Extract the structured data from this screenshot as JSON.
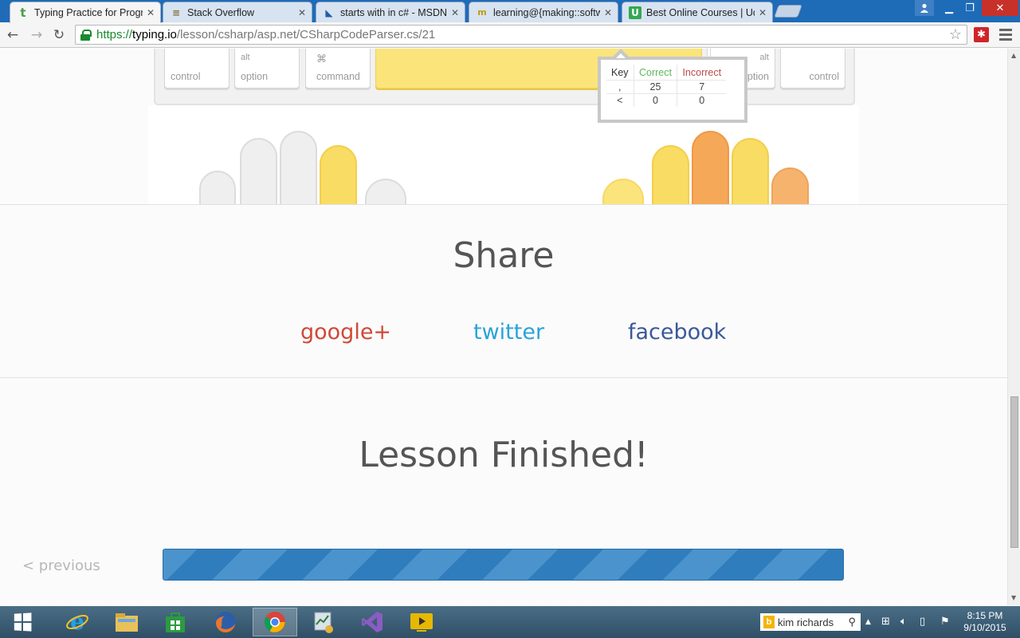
{
  "browser": {
    "tabs": [
      {
        "title": "Typing Practice for Progra",
        "favicon": "typing-io-icon",
        "active": true
      },
      {
        "title": "Stack Overflow",
        "favicon": "stackoverflow-icon",
        "active": false
      },
      {
        "title": "starts with in c# - MSDN S",
        "favicon": "msdn-icon",
        "active": false
      },
      {
        "title": "learning@{making::softwa",
        "favicon": "blog-icon",
        "active": false
      },
      {
        "title": "Best Online Courses | Ude",
        "favicon": "udemy-icon",
        "active": false
      }
    ],
    "url_scheme": "https://",
    "url_host": "typing.io",
    "url_path": "/lesson/csharp/asp.net/CSharpCodeParser.cs/21",
    "extension_label": "✱"
  },
  "keyboard": {
    "keys": {
      "left_control": "control",
      "left_option_sup": "alt",
      "left_option": "option",
      "command_sup": "⌘",
      "command": "command",
      "right_option_sup": "alt",
      "right_option": "option",
      "right_control": "control"
    }
  },
  "stats_tooltip": {
    "headers": [
      "Key",
      "Correct",
      "Incorrect"
    ],
    "rows": [
      {
        "key": ",",
        "correct": "25",
        "incorrect": "7"
      },
      {
        "key": "<",
        "correct": "0",
        "incorrect": "0"
      }
    ],
    "colors": {
      "correct": "#5cb85c",
      "incorrect": "#b94a48"
    }
  },
  "share": {
    "title": "Share",
    "google": "google+",
    "twitter": "twitter",
    "facebook": "facebook",
    "colors": {
      "google": "#d14836",
      "twitter": "#2aa3d8",
      "facebook": "#3b5998"
    }
  },
  "lesson": {
    "finished_title": "Lesson Finished!",
    "previous": "< previous",
    "progress_percent": 100
  },
  "taskbar": {
    "pinned": [
      "internet-explorer-icon",
      "file-explorer-icon",
      "store-icon",
      "firefox-icon",
      "chrome-icon",
      "finance-app-icon",
      "visual-studio-icon",
      "media-app-icon"
    ],
    "active": "chrome-icon",
    "search_text": "kim richards",
    "time": "8:15 PM",
    "date": "9/10/2015"
  }
}
